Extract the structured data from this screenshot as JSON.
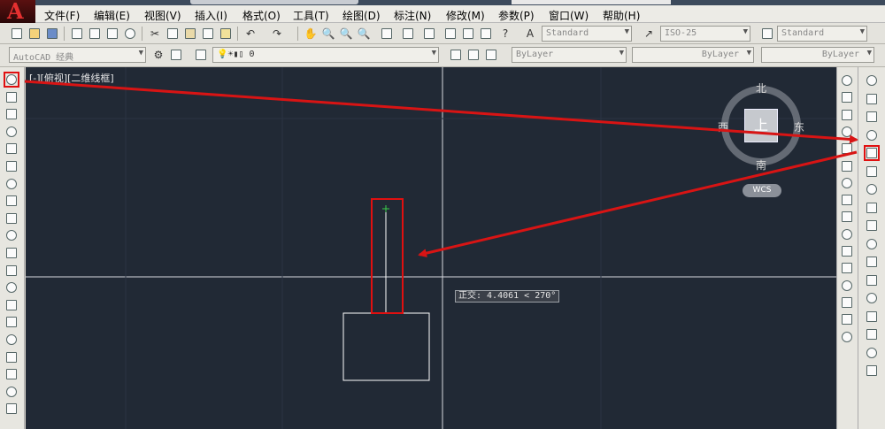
{
  "app": {
    "logo_letter": "A"
  },
  "menu": [
    "文件(F)",
    "编辑(E)",
    "视图(V)",
    "插入(I)",
    "格式(O)",
    "工具(T)",
    "绘图(D)",
    "标注(N)",
    "修改(M)",
    "参数(P)",
    "窗口(W)",
    "帮助(H)"
  ],
  "toolbar1": {
    "text_style": "Standard",
    "dim_style": "ISO-25",
    "table_style": "Standard"
  },
  "toolbar2": {
    "workspace": "AutoCAD 经典",
    "layer": "0",
    "color": "ByLayer",
    "linetype": "ByLayer",
    "lineweight": "ByLayer"
  },
  "viewport": {
    "label": "[-][俯视][二维线框]",
    "tooltip": "正交: 4.4061 < 270°"
  },
  "viewcube": {
    "north": "北",
    "south": "南",
    "east": "东",
    "west": "西",
    "face": "上",
    "wcs": "WCS"
  },
  "colors": {
    "canvas": "#212935",
    "highlight": "#e01010",
    "arrow": "#d81414"
  },
  "left_tools": [
    "line-icon",
    "construction-line-icon",
    "polyline-icon",
    "polygon-icon",
    "rectangle-icon",
    "arc-icon",
    "circle-icon",
    "revision-cloud-icon",
    "spline-icon",
    "ellipse-icon",
    "ellipse-arc-icon",
    "insert-block-icon",
    "make-block-icon",
    "point-icon",
    "hatch-icon",
    "gradient-icon",
    "region-icon",
    "table-icon",
    "multiline-text-icon",
    "add-selected-icon"
  ],
  "right_tools_1": [
    "view-top-icon",
    "view-bottom-icon",
    "view-left-icon",
    "view-right-icon",
    "orbit-icon",
    "sw-iso-icon",
    "se-iso-icon",
    "zoom-window-icon",
    "zoom-dynamic-icon",
    "zoom-scale-icon",
    "zoom-center-icon",
    "zoom-object-icon",
    "zoom-in-icon",
    "zoom-out-icon",
    "zoom-all-icon",
    "zoom-extents-icon"
  ],
  "right_tools_2": [
    "snap-tracking-icon",
    "snap-from-icon",
    "snap-endpoint-icon",
    "snap-midpoint-icon",
    "snap-intersection-icon",
    "snap-apparent-icon",
    "snap-extension-icon",
    "snap-center-icon",
    "snap-quadrant-icon",
    "snap-tangent-icon",
    "snap-perpendicular-icon",
    "snap-parallel-icon",
    "snap-insert-icon",
    "snap-node-icon",
    "snap-nearest-icon",
    "snap-none-icon",
    "snap-settings-icon"
  ]
}
